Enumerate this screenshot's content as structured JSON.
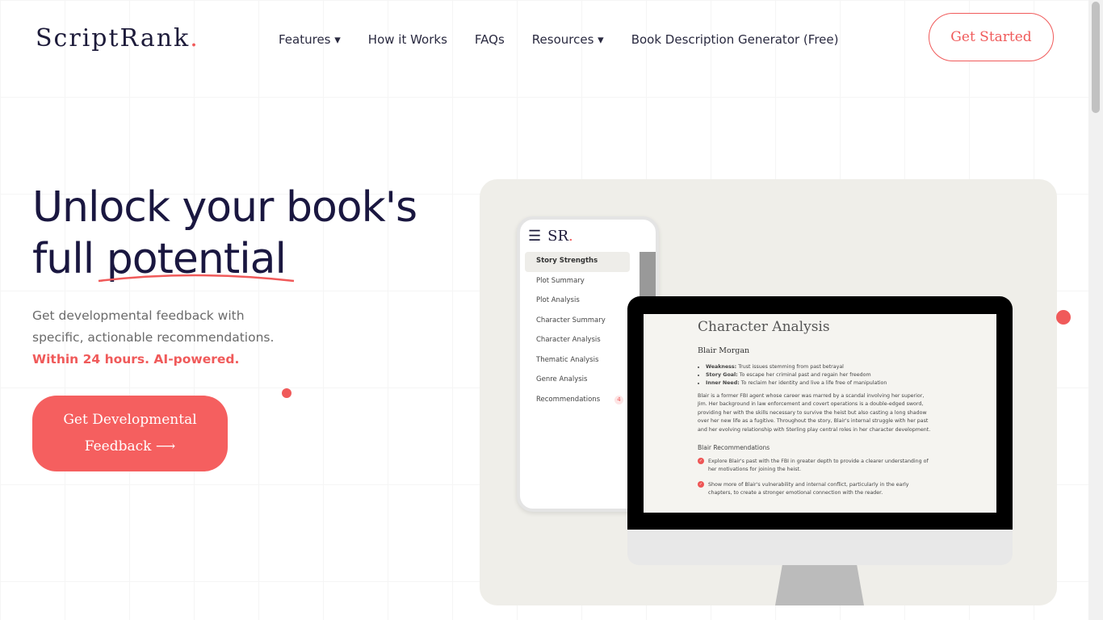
{
  "header": {
    "logo": "ScriptRank",
    "logo_dot": ".",
    "nav": [
      "Features ▾",
      "How it Works",
      "FAQs",
      "Resources ▾",
      "Book Description Generator (Free)"
    ],
    "cta": "Get Started"
  },
  "hero": {
    "title_line1": "Unlock your book's",
    "title_line2": "full potential",
    "subtitle": "Get developmental feedback with specific, actionable recommendations.",
    "highlight": "Within 24 hours. AI-powered.",
    "cta": "Get Developmental Feedback",
    "cta_arrow": "⟶"
  },
  "phone": {
    "logo": "SR",
    "menu_icon": "☰",
    "items": [
      "Story Strengths",
      "Plot Summary",
      "Plot Analysis",
      "Character Summary",
      "Character Analysis",
      "Thematic Analysis",
      "Genre Analysis",
      "Recommendations"
    ],
    "badge": "4"
  },
  "screen": {
    "title": "Character Analysis",
    "character": "Blair Morgan",
    "traits": [
      {
        "k": "Weakness:",
        "v": " Trust issues stemming from past betrayal"
      },
      {
        "k": "Story Goal:",
        "v": " To escape her criminal past and regain her freedom"
      },
      {
        "k": "Inner Need:",
        "v": " To reclaim her identity and live a life free of manipulation"
      }
    ],
    "paragraph": "Blair is a former FBI agent whose career was marred by a scandal involving her superior, Jim. Her background in law enforcement and covert operations is a double-edged sword, providing her with the skills necessary to survive the heist but also casting a long shadow over her new life as a fugitive. Throughout the story, Blair's internal struggle with her past and her evolving relationship with Sterling play central roles in her character development.",
    "rec_title": "Blair Recommendations",
    "recs": [
      "Explore Blair's past with the FBI in greater depth to provide a clearer understanding of her motivations for joining the heist.",
      "Show more of Blair's vulnerability and internal conflict, particularly in the early chapters, to create a stronger emotional connection with the reader."
    ]
  },
  "colors": {
    "accent": "#f05a5a",
    "heading": "#1a1740"
  }
}
